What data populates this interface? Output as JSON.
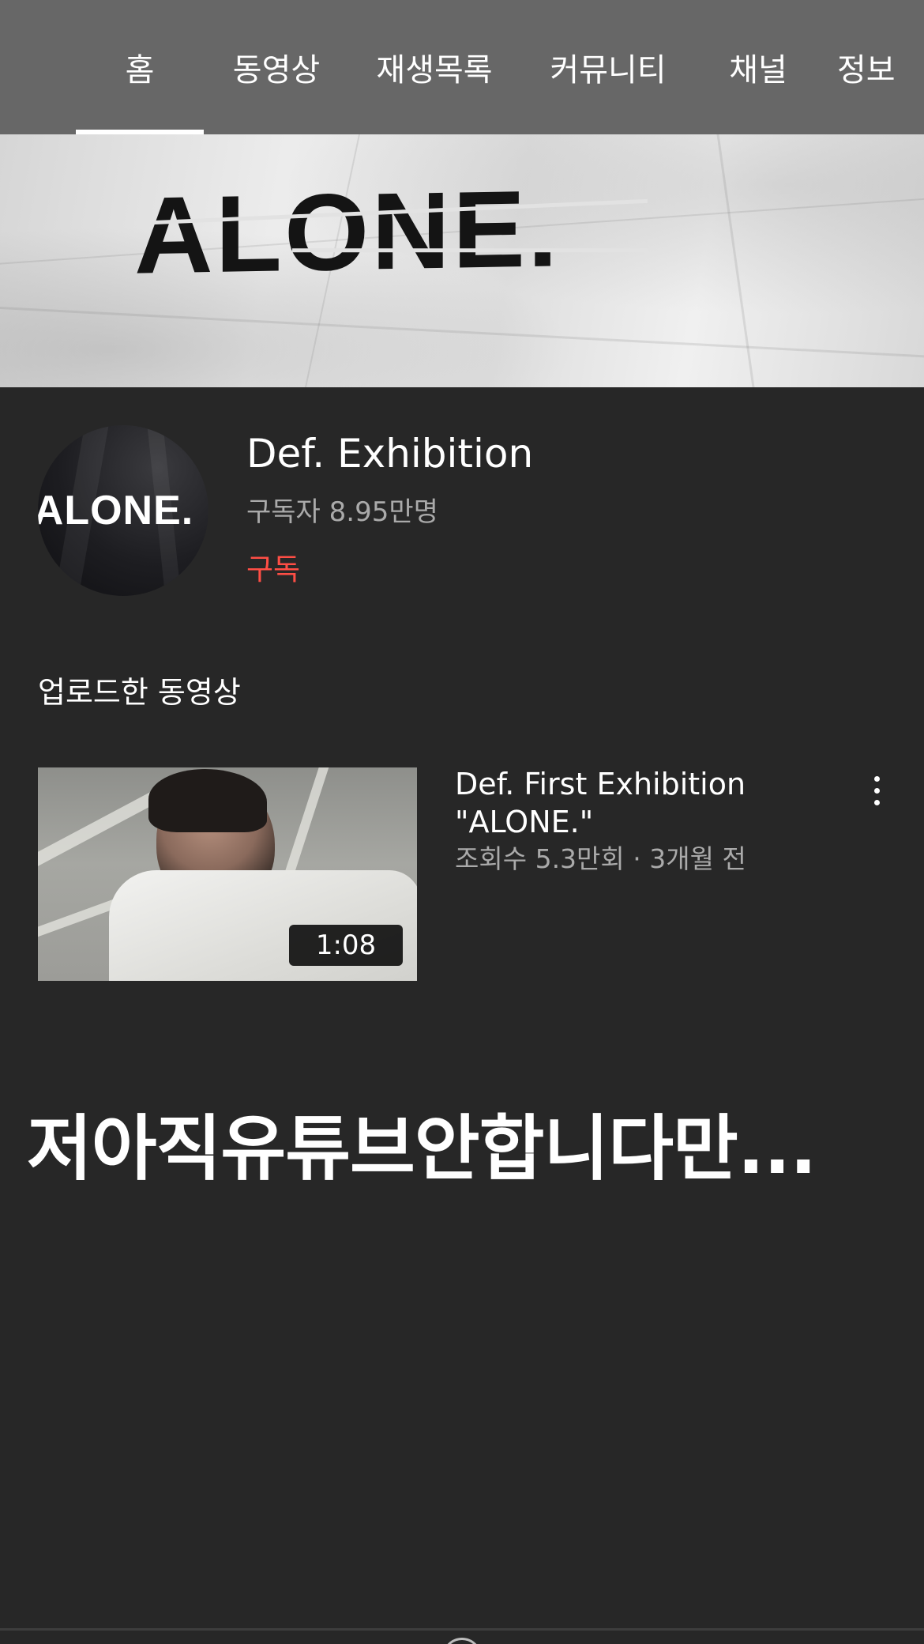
{
  "tabs": [
    {
      "label": "홈",
      "active": true
    },
    {
      "label": "동영상",
      "active": false
    },
    {
      "label": "재생목록",
      "active": false
    },
    {
      "label": "커뮤니티",
      "active": false
    },
    {
      "label": "채널",
      "active": false
    },
    {
      "label": "정보",
      "active": false
    }
  ],
  "banner": {
    "logo_text": "ALONE."
  },
  "channel": {
    "avatar_text": "ALONE.",
    "name": "Def. Exhibition",
    "subscribers": "구독자 8.95만명",
    "subscribe_label": "구독"
  },
  "section": {
    "title": "업로드한 동영상"
  },
  "video": {
    "title": "Def. First Exhibition \"ALONE.\"",
    "meta": "조회수 5.3만회 · 3개월 전",
    "duration": "1:08",
    "more_icon": "more-vert-icon"
  },
  "overlay_caption": "저아직유튜브안합니다만...",
  "colors": {
    "tabbar_bg": "#676767",
    "page_bg": "#272727",
    "subscribe_red": "#ff4e45",
    "secondary_text": "#aaaaaa"
  }
}
